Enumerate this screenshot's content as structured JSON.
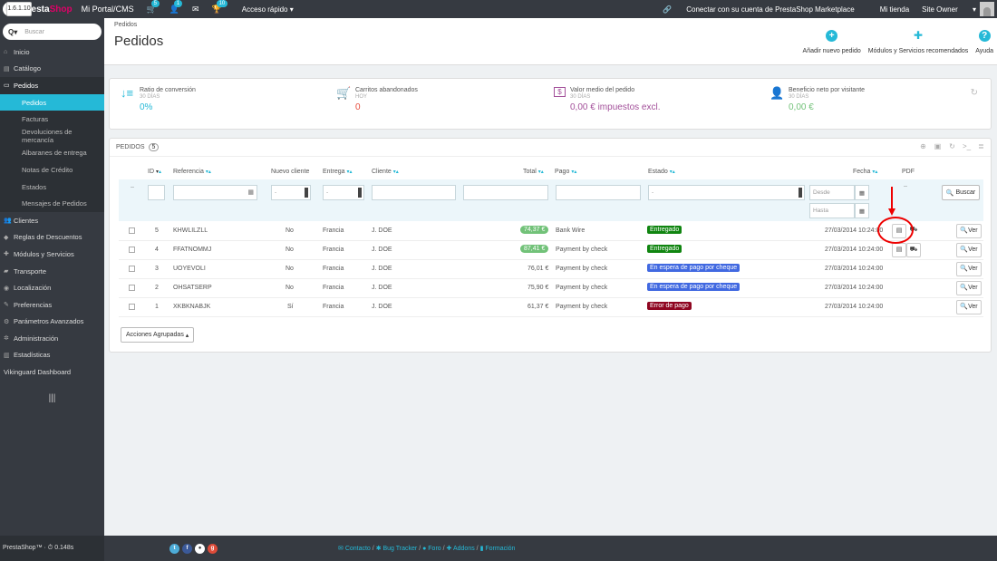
{
  "topbar": {
    "brand_part1": "Presta",
    "brand_part2": "Shop",
    "version": "1.6.1.10",
    "portal": "Mi Portal/CMS",
    "badges": {
      "cart": "5",
      "users": "1",
      "messages": "",
      "trophy": "10"
    },
    "quick_access": "Acceso rápido",
    "marketplace": "Conectar con su cuenta de PrestaShop Marketplace",
    "mi_tienda": "Mi tienda",
    "site_owner": "Site Owner"
  },
  "sidebar": {
    "search_prefix": "Q▾",
    "search_placeholder": "Buscar",
    "items": [
      {
        "label": "Inicio",
        "icon": "home-icon"
      },
      {
        "label": "Catálogo",
        "icon": "catalog-icon"
      },
      {
        "label": "Pedidos",
        "icon": "orders-icon"
      },
      {
        "label": "Clientes",
        "icon": "customers-icon"
      },
      {
        "label": "Reglas de Descuentos",
        "icon": "tag-icon"
      },
      {
        "label": "Módulos y Servicios",
        "icon": "puzzle-icon"
      },
      {
        "label": "Transporte",
        "icon": "truck-icon"
      },
      {
        "label": "Localización",
        "icon": "globe-icon"
      },
      {
        "label": "Preferencias",
        "icon": "wrench-icon"
      },
      {
        "label": "Parámetros Avanzados",
        "icon": "cogs-icon"
      },
      {
        "label": "Administración",
        "icon": "gear-icon"
      },
      {
        "label": "Estadísticas",
        "icon": "bar-chart-icon"
      },
      {
        "label": "Vikinguard Dashboard",
        "icon": ""
      }
    ],
    "subitems": [
      "Pedidos",
      "Facturas",
      "Devoluciones de mercancía",
      "Albaranes de entrega",
      "Notas de Crédito",
      "Estados",
      "Mensajes de Pedidos"
    ],
    "collapse": "|||"
  },
  "header": {
    "breadcrumb": "Pedidos",
    "title": "Pedidos",
    "buttons": {
      "add": "Añadir nuevo pedido",
      "modules": "Módulos y Servicios recomendados",
      "help": "Ayuda"
    }
  },
  "kpis": [
    {
      "title": "Ratio de conversión",
      "sub": "30 DÍAS",
      "value": "0%",
      "color": "#25b9d7",
      "icon": "↓≡"
    },
    {
      "title": "Carritos abandonados",
      "sub": "HOY",
      "value": "0",
      "color": "#e74c3c",
      "icon": "🛒"
    },
    {
      "title": "Valor medio del pedido",
      "sub": "30 DÍAS",
      "value": "0,00 € impuestos excl.",
      "color": "#a3509a",
      "icon": "$"
    },
    {
      "title": "Beneficio neto por visitante",
      "sub": "30 DÍAS",
      "value": "0,00 €",
      "color": "#72c279",
      "icon": "👤"
    }
  ],
  "panel": {
    "title": "PEDIDOS",
    "count": "5",
    "columns": {
      "id": "ID",
      "ref": "Referencia",
      "nuevo": "Nuevo cliente",
      "entrega": "Entrega",
      "cliente": "Cliente",
      "total": "Total",
      "pago": "Pago",
      "estado": "Estado",
      "fecha": "Fecha",
      "pdf": "PDF"
    },
    "filter": {
      "select_dash": "-",
      "desde": "Desde",
      "hasta": "Hasta",
      "buscar": "Buscar",
      "pdf_dash": "--",
      "leading_dash": "--"
    },
    "rows": [
      {
        "id": "5",
        "ref": "KHWLILZLL",
        "nuevo": "No",
        "entrega": "Francia",
        "cliente": "J. DOE",
        "total": "74,37 €",
        "total_badge": true,
        "pago": "Bank Wire",
        "estado": "Entregado",
        "estado_color": "#108510",
        "fecha": "27/03/2014 10:24:00",
        "pdf": 2
      },
      {
        "id": "4",
        "ref": "FFATNOMMJ",
        "nuevo": "No",
        "entrega": "Francia",
        "cliente": "J. DOE",
        "total": "87,41 €",
        "total_badge": true,
        "pago": "Payment by check",
        "estado": "Entregado",
        "estado_color": "#108510",
        "fecha": "27/03/2014 10:24:00",
        "pdf": 2
      },
      {
        "id": "3",
        "ref": "UOYEVOLI",
        "nuevo": "No",
        "entrega": "Francia",
        "cliente": "J. DOE",
        "total": "76,01 €",
        "total_badge": false,
        "pago": "Payment by check",
        "estado": "En espera de pago por cheque",
        "estado_color": "#4169e1",
        "fecha": "27/03/2014 10:24:00",
        "pdf": 0
      },
      {
        "id": "2",
        "ref": "OHSATSERP",
        "nuevo": "No",
        "entrega": "Francia",
        "cliente": "J. DOE",
        "total": "75,90 €",
        "total_badge": false,
        "pago": "Payment by check",
        "estado": "En espera de pago por cheque",
        "estado_color": "#4169e1",
        "fecha": "27/03/2014 10:24:00",
        "pdf": 0
      },
      {
        "id": "1",
        "ref": "XKBKNABJK",
        "nuevo": "Sí",
        "entrega": "Francia",
        "cliente": "J. DOE",
        "total": "61,37 €",
        "total_badge": false,
        "pago": "Payment by check",
        "estado": "Error de pago",
        "estado_color": "#8f0621",
        "fecha": "27/03/2014 10:24:00",
        "pdf": 0
      }
    ],
    "ver": "Ver",
    "bulk": "Acciones Agrupadas"
  },
  "footer": {
    "left": "PrestaShop™ · ⏱ 0.148s",
    "links": [
      "Contacto",
      "Bug Tracker",
      "Foro",
      "Addons",
      "Formación"
    ]
  }
}
